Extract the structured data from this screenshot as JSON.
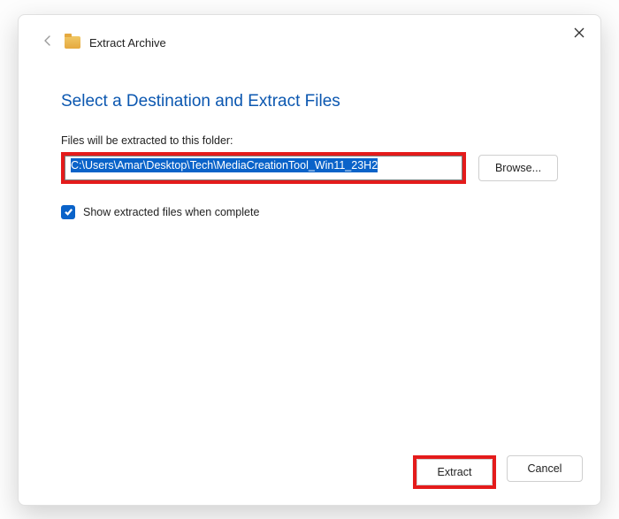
{
  "window": {
    "title": "Extract Archive"
  },
  "heading": "Select a Destination and Extract Files",
  "field_label": "Files will be extracted to this folder:",
  "path_value": "C:\\Users\\Amar\\Desktop\\Tech\\MediaCreationTool_Win11_23H2",
  "browse_label": "Browse...",
  "checkbox": {
    "checked": true,
    "label": "Show extracted files when complete"
  },
  "footer": {
    "extract_label": "Extract",
    "cancel_label": "Cancel"
  },
  "colors": {
    "accent": "#0a63c9",
    "heading": "#0b57b0",
    "highlight_border": "#e41b1b"
  }
}
